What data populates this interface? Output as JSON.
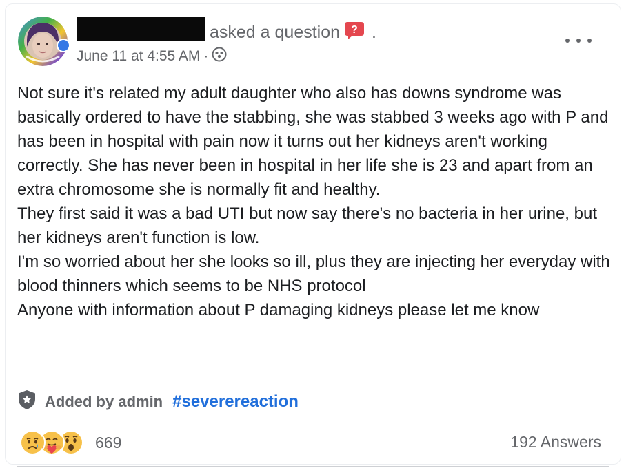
{
  "header": {
    "action_text": "asked a question",
    "trailing_dot": ".",
    "timestamp": "June 11 at 4:55 AM",
    "meta_separator": "·",
    "privacy_icon": "group-members-icon",
    "question_icon": "question-bubble-icon",
    "avatar_icon": "profile-avatar",
    "more_icon": "more-options-icon"
  },
  "post": {
    "paragraphs": [
      "Not sure it's related my adult daughter who also has downs syndrome was basically ordered to have the stabbing, she was stabbed 3 weeks ago with P and has been in hospital with pain now it turns out her kidneys aren't working correctly. She has never been in hospital in her life she is 23 and apart from an extra chromosome she is normally fit and healthy.",
      "They first said it was a bad UTI but now say there's no bacteria in her urine, but her kidneys aren't function is low.",
      "I'm so worried about her she looks so ill, plus they are injecting her everyday with blood thinners which seems to be NHS protocol",
      "Anyone with information about P damaging kidneys please let me know"
    ]
  },
  "tag": {
    "icon": "admin-shield-icon",
    "label": "Added by admin",
    "hashtag": "#severereaction"
  },
  "footer": {
    "reactions": [
      "sad",
      "care",
      "wow"
    ],
    "reaction_count": "669",
    "answers": "192 Answers"
  },
  "colors": {
    "text": "#1c1e21",
    "secondary": "#65676b",
    "link": "#216fdb",
    "question_icon": "#e4474f",
    "reaction_yellow": "#f7c14a"
  }
}
